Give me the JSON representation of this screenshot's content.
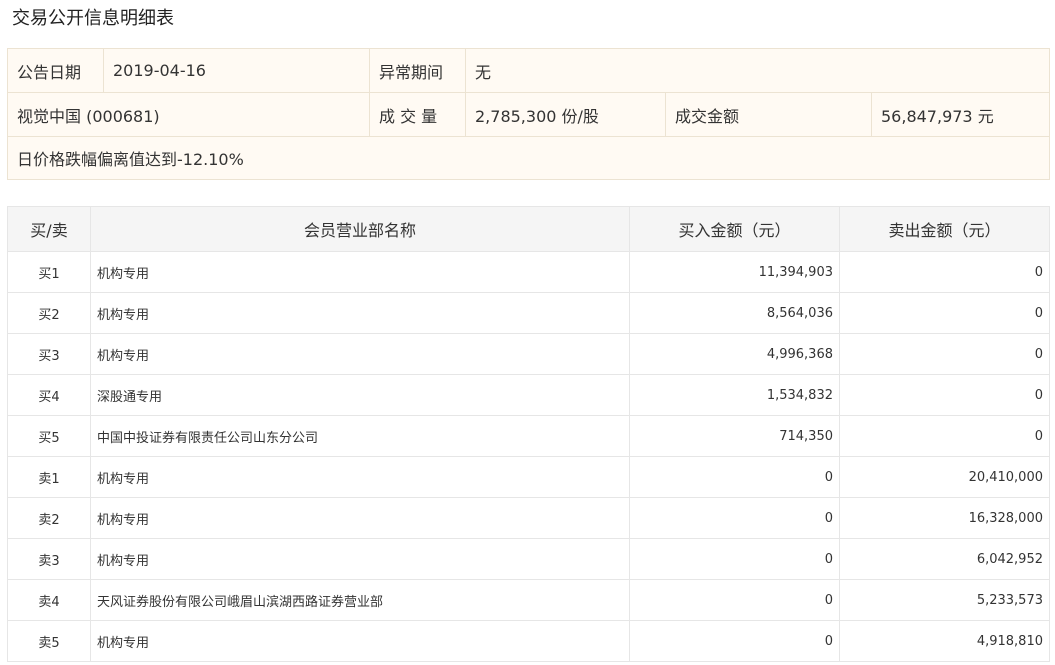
{
  "page_title": "交易公开信息明细表",
  "summary": {
    "date_label": "公告日期",
    "date_value": "2019-04-16",
    "abnormal_label": "异常期间",
    "abnormal_value": "无",
    "stock": "视觉中国 (000681)",
    "volume_label": "成 交 量",
    "volume_value": "2,785,300 份/股",
    "amount_label": "成交金额",
    "amount_value": "56,847,973 元",
    "reason": "日价格跌幅偏离值达到-12.10%"
  },
  "table": {
    "headers": [
      "买/卖",
      "会员营业部名称",
      "买入金额（元）",
      "卖出金额（元）"
    ],
    "rows": [
      {
        "side": "买1",
        "name": "机构专用",
        "buy": "11,394,903",
        "sell": "0"
      },
      {
        "side": "买2",
        "name": "机构专用",
        "buy": "8,564,036",
        "sell": "0"
      },
      {
        "side": "买3",
        "name": "机构专用",
        "buy": "4,996,368",
        "sell": "0"
      },
      {
        "side": "买4",
        "name": "深股通专用",
        "buy": "1,534,832",
        "sell": "0"
      },
      {
        "side": "买5",
        "name": "中国中投证券有限责任公司山东分公司",
        "buy": "714,350",
        "sell": "0"
      },
      {
        "side": "卖1",
        "name": "机构专用",
        "buy": "0",
        "sell": "20,410,000"
      },
      {
        "side": "卖2",
        "name": "机构专用",
        "buy": "0",
        "sell": "16,328,000"
      },
      {
        "side": "卖3",
        "name": "机构专用",
        "buy": "0",
        "sell": "6,042,952"
      },
      {
        "side": "卖4",
        "name": "天风证券股份有限公司峨眉山滨湖西路证券营业部",
        "buy": "0",
        "sell": "5,233,573"
      },
      {
        "side": "卖5",
        "name": "机构专用",
        "buy": "0",
        "sell": "4,918,810"
      }
    ]
  }
}
